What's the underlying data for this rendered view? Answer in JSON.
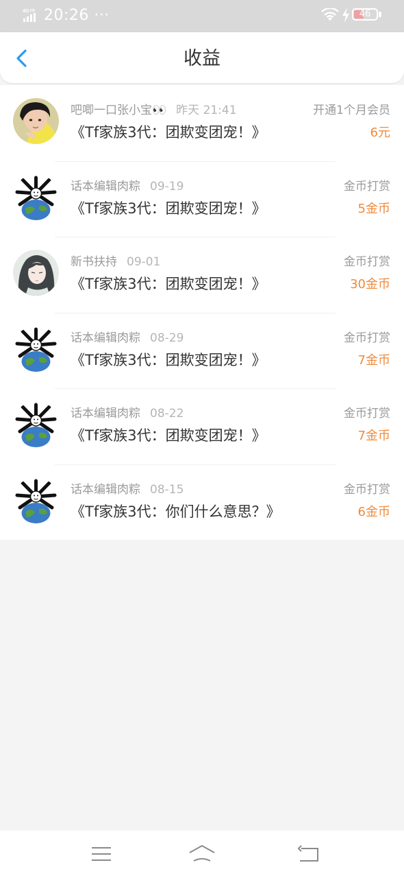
{
  "status_bar": {
    "network": "4G HD",
    "time": "20:26",
    "dots": "···",
    "battery": "46"
  },
  "header": {
    "title": "收益",
    "back_icon": "chevron-left-icon"
  },
  "colors": {
    "accent": "#2a9bf0",
    "amount": "#f08a3a",
    "status_bar_bg": "#d9d9d9",
    "page_bg": "#f5f4f5"
  },
  "earnings": [
    {
      "avatar": "boy-photo",
      "name": "吧唧一口张小宝👀",
      "date": "昨天 21:41",
      "book": "《Tf家族3代：团欺变团宠！》",
      "type": "开通1个月会员",
      "amount": "6元"
    },
    {
      "avatar": "meme-globe",
      "name": "话本编辑肉粽",
      "date": "09-19",
      "book": "《Tf家族3代：团欺变团宠！》",
      "type": "金币打赏",
      "amount": "5金币"
    },
    {
      "avatar": "anime-portrait",
      "name": "新书扶持",
      "date": "09-01",
      "book": "《Tf家族3代：团欺变团宠！》",
      "type": "金币打赏",
      "amount": "30金币"
    },
    {
      "avatar": "meme-globe",
      "name": "话本编辑肉粽",
      "date": "08-29",
      "book": "《Tf家族3代：团欺变团宠！》",
      "type": "金币打赏",
      "amount": "7金币"
    },
    {
      "avatar": "meme-globe",
      "name": "话本编辑肉粽",
      "date": "08-22",
      "book": "《Tf家族3代：团欺变团宠！》",
      "type": "金币打赏",
      "amount": "7金币"
    },
    {
      "avatar": "meme-globe",
      "name": "话本编辑肉粽",
      "date": "08-15",
      "book": "《Tf家族3代：你们什么意思？》",
      "type": "金币打赏",
      "amount": "6金币"
    }
  ],
  "bottom_nav": {
    "menu_icon": "menu-icon",
    "home_icon": "home-icon",
    "back_icon": "back-arrow-icon"
  }
}
